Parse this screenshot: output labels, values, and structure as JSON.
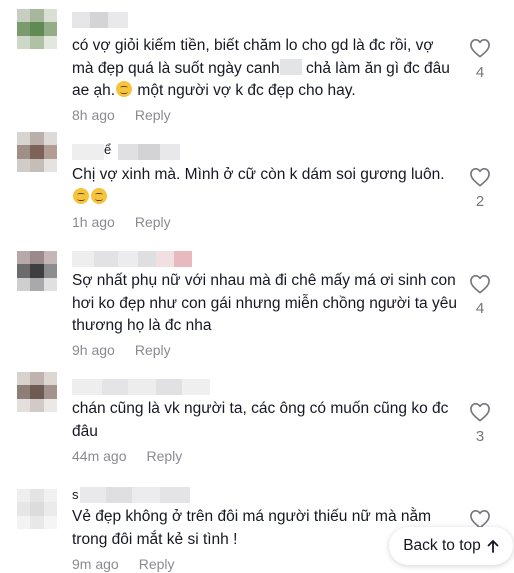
{
  "comments": [
    {
      "text_part1": "có vợ giỏi kiếm tiền, biết chăm lo cho gd là đc rồi, vợ mà đẹp quá là suốt ngày canh",
      "text_part2": " chả làm ăn gì đc đâu ae ạh.",
      "text_part3": " một người vợ k đc đẹp cho hay.",
      "time": "8h ago",
      "reply": "Reply",
      "likes": "4"
    },
    {
      "username_fragment": "ể",
      "text": "Chị vợ xinh mà. Mình ở cữ còn k dám soi gương luôn.",
      "time": "1h ago",
      "reply": "Reply",
      "likes": "2"
    },
    {
      "text": "Sợ nhất phụ nữ với nhau mà đi chê mấy má ơi sinh con hơi ko đẹp như con gái nhưng miễn chồng người ta yêu thương họ là đc nha",
      "time": "9h ago",
      "reply": "Reply",
      "likes": "4"
    },
    {
      "text": "chán cũng là vk người ta, các ông có muốn cũng ko đc đâu",
      "time": "44m ago",
      "reply": "Reply",
      "likes": "3"
    },
    {
      "username_fragment": "s",
      "text": "Vẻ đẹp không ở trên đôi má người thiếu nữ mà nằm trong đôi mắt kẻ si tình !",
      "time": "9m ago",
      "reply": "Reply",
      "likes": ""
    }
  ],
  "back_to_top": {
    "label": "Back to top"
  },
  "colors": {
    "text": "#161823",
    "meta": "#8a8b91",
    "like_icon": "#75767c"
  },
  "icons": {
    "like": "heart-outline-icon",
    "back_to_top": "arrow-up-icon",
    "emoji_laugh": "grinning-sweat-emoji",
    "emoji_sad": "pensive-emoji"
  }
}
